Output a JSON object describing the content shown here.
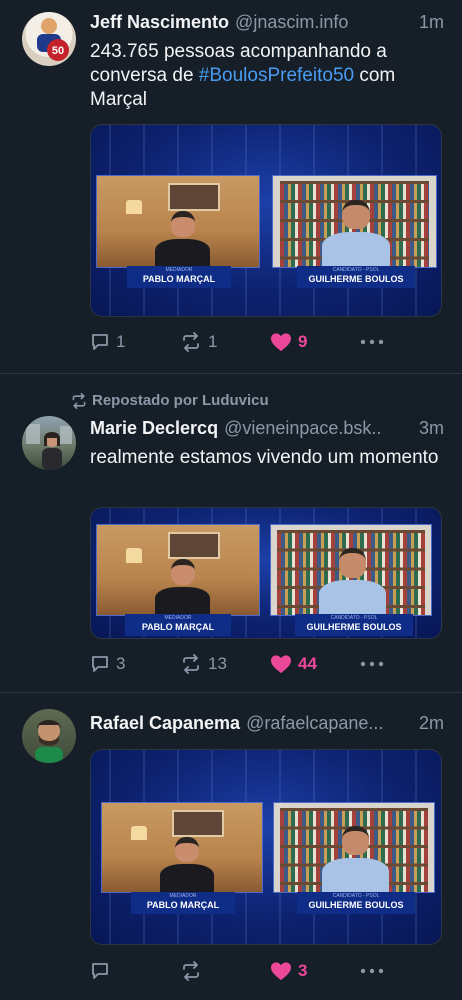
{
  "colors": {
    "background": "#161e27",
    "link": "#4a9bf2",
    "like": "#ec4899",
    "muted": "#8a98a8"
  },
  "posts": [
    {
      "author": "Jeff Nascimento",
      "handle": "@jnascim.info",
      "time": "1m",
      "text_before": "243.765 pessoas acompanhando a conversa de ",
      "hashtag": "#BoulosPrefeito50",
      "text_after": " com Marçal",
      "media": {
        "left_caption_small": "MEDIADOR",
        "left_caption": "PABLO MARÇAL",
        "right_caption_small": "CANDIDATO - PSOL",
        "right_caption": "GUILHERME BOULOS"
      },
      "replies": "1",
      "reposts": "1",
      "likes": "9",
      "liked": true
    },
    {
      "repost_label": "Repostado por Luduvicu",
      "author": "Marie Declercq",
      "handle": "@vieneinpace.bsk..",
      "time": "3m",
      "text": "realmente estamos vivendo um momento",
      "media": {
        "left_caption_small": "MEDIADOR",
        "left_caption": "PABLO MARÇAL",
        "right_caption_small": "CANDIDATO - PSOL",
        "right_caption": "GUILHERME BOULOS"
      },
      "replies": "3",
      "reposts": "13",
      "likes": "44",
      "liked": true
    },
    {
      "author": "Rafael Capanema",
      "handle": "@rafaelcapane...",
      "time": "2m",
      "media": {
        "left_caption_small": "MEDIADOR",
        "left_caption": "PABLO MARÇAL",
        "right_caption_small": "CANDIDATO - PSOL",
        "right_caption": "GUILHERME BOULOS"
      },
      "replies": "",
      "reposts": "",
      "likes": "3",
      "liked": true
    }
  ]
}
